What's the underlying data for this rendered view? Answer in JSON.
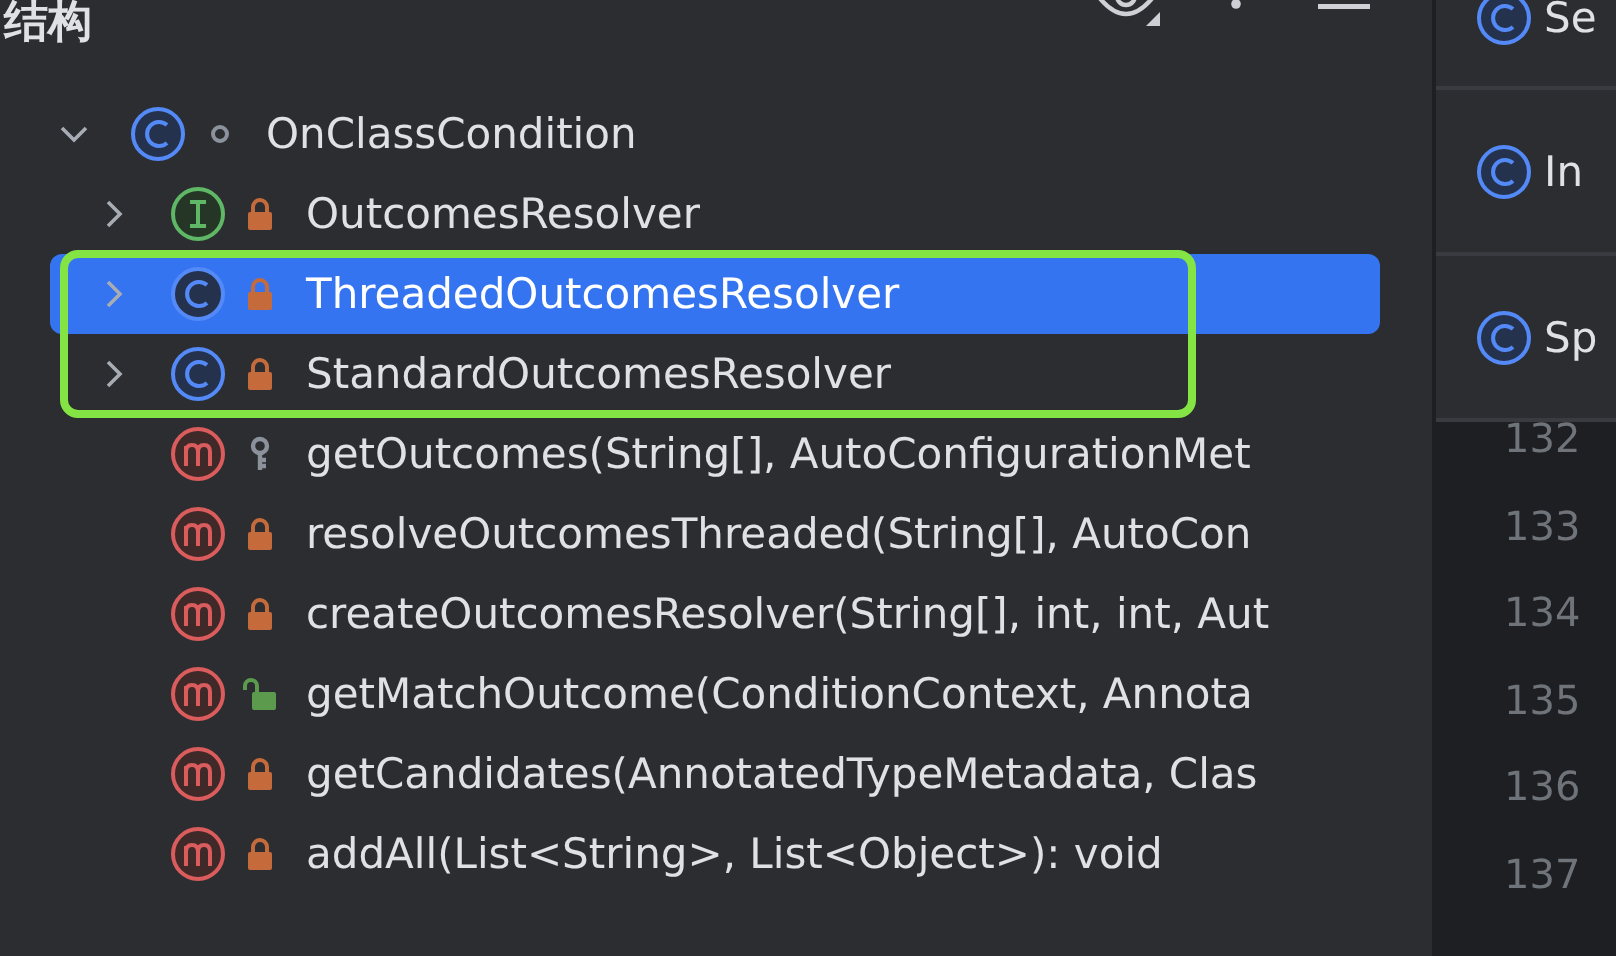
{
  "panel": {
    "title": "结构"
  },
  "tree": [
    {
      "label": "OnClassCondition",
      "kind": "class",
      "access": {
        "kind": "package"
      },
      "expanded": true,
      "selected": false,
      "annotated": false,
      "children": [
        {
          "label": "OutcomesResolver",
          "kind": "interface",
          "access": {
            "kind": "private"
          },
          "expanded": false,
          "selected": false,
          "annotated": false
        },
        {
          "label": "ThreadedOutcomesResolver",
          "kind": "class",
          "access": {
            "kind": "private"
          },
          "expanded": false,
          "selected": true,
          "annotated": true
        },
        {
          "label": "StandardOutcomesResolver",
          "kind": "class",
          "access": {
            "kind": "private"
          },
          "expanded": false,
          "selected": false,
          "annotated": true
        },
        {
          "label": "getOutcomes(String[], AutoConfigurationMet",
          "kind": "method",
          "access": {
            "kind": "protected"
          },
          "selected": false,
          "annotated": false
        },
        {
          "label": "resolveOutcomesThreaded(String[], AutoCon",
          "kind": "method",
          "access": {
            "kind": "private"
          },
          "selected": false,
          "annotated": false
        },
        {
          "label": "createOutcomesResolver(String[], int, int, Aut",
          "kind": "method",
          "access": {
            "kind": "private"
          },
          "selected": false,
          "annotated": false
        },
        {
          "label": "getMatchOutcome(ConditionContext, Annota",
          "kind": "method",
          "access": {
            "kind": "public"
          },
          "selected": false,
          "annotated": false
        },
        {
          "label": "getCandidates(AnnotatedTypeMetadata, Clas",
          "kind": "method",
          "access": {
            "kind": "private"
          },
          "selected": false,
          "annotated": false
        },
        {
          "label": "addAll(List<String>, List<Object>): void",
          "kind": "method",
          "access": {
            "kind": "private"
          },
          "selected": false,
          "annotated": false
        }
      ]
    }
  ],
  "side_list": [
    {
      "label": "Se",
      "kind": "class"
    },
    {
      "label": "In",
      "kind": "class"
    },
    {
      "label": "Sp",
      "kind": "class"
    }
  ],
  "line_numbers": [
    "132",
    "133",
    "134",
    "135",
    "136",
    "137"
  ]
}
